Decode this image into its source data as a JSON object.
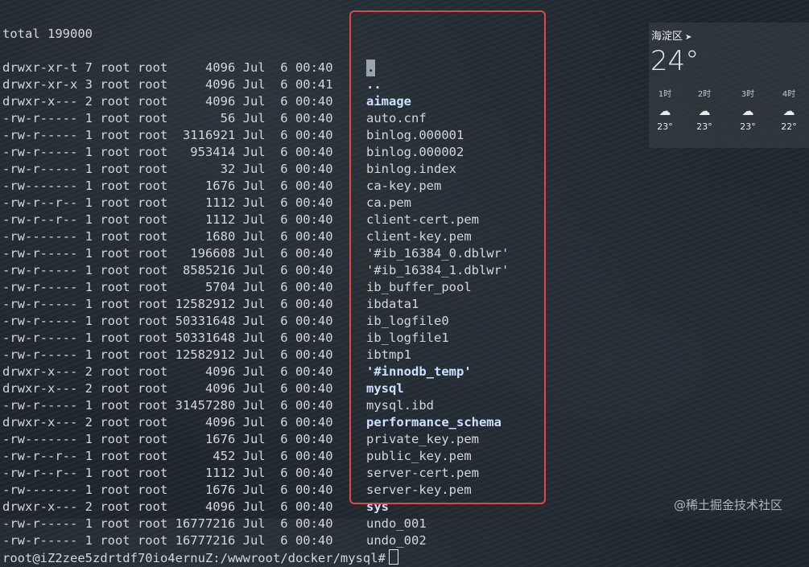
{
  "terminal": {
    "header": "total 199000",
    "rows": [
      {
        "meta": "drwxr-xr-t 7 root root     4096 Jul  6 00:40",
        "name": ".",
        "is_dir": true
      },
      {
        "meta": "drwxr-xr-x 3 root root     4096 Jul  6 00:41",
        "name": "..",
        "is_dir": true
      },
      {
        "meta": "drwxr-x--- 2 root root     4096 Jul  6 00:40",
        "name": "aimage",
        "is_dir": true
      },
      {
        "meta": "-rw-r----- 1 root root       56 Jul  6 00:40",
        "name": "auto.cnf",
        "is_dir": false
      },
      {
        "meta": "-rw-r----- 1 root root  3116921 Jul  6 00:40",
        "name": "binlog.000001",
        "is_dir": false
      },
      {
        "meta": "-rw-r----- 1 root root   953414 Jul  6 00:40",
        "name": "binlog.000002",
        "is_dir": false
      },
      {
        "meta": "-rw-r----- 1 root root       32 Jul  6 00:40",
        "name": "binlog.index",
        "is_dir": false
      },
      {
        "meta": "-rw------- 1 root root     1676 Jul  6 00:40",
        "name": "ca-key.pem",
        "is_dir": false
      },
      {
        "meta": "-rw-r--r-- 1 root root     1112 Jul  6 00:40",
        "name": "ca.pem",
        "is_dir": false
      },
      {
        "meta": "-rw-r--r-- 1 root root     1112 Jul  6 00:40",
        "name": "client-cert.pem",
        "is_dir": false
      },
      {
        "meta": "-rw------- 1 root root     1680 Jul  6 00:40",
        "name": "client-key.pem",
        "is_dir": false
      },
      {
        "meta": "-rw-r----- 1 root root   196608 Jul  6 00:40",
        "name": "'#ib_16384_0.dblwr'",
        "is_dir": false
      },
      {
        "meta": "-rw-r----- 1 root root  8585216 Jul  6 00:40",
        "name": "'#ib_16384_1.dblwr'",
        "is_dir": false
      },
      {
        "meta": "-rw-r----- 1 root root     5704 Jul  6 00:40",
        "name": "ib_buffer_pool",
        "is_dir": false
      },
      {
        "meta": "-rw-r----- 1 root root 12582912 Jul  6 00:40",
        "name": "ibdata1",
        "is_dir": false
      },
      {
        "meta": "-rw-r----- 1 root root 50331648 Jul  6 00:40",
        "name": "ib_logfile0",
        "is_dir": false
      },
      {
        "meta": "-rw-r----- 1 root root 50331648 Jul  6 00:40",
        "name": "ib_logfile1",
        "is_dir": false
      },
      {
        "meta": "-rw-r----- 1 root root 12582912 Jul  6 00:40",
        "name": "ibtmp1",
        "is_dir": false
      },
      {
        "meta": "drwxr-x--- 2 root root     4096 Jul  6 00:40",
        "name": "'#innodb_temp'",
        "is_dir": true
      },
      {
        "meta": "drwxr-x--- 2 root root     4096 Jul  6 00:40",
        "name": "mysql",
        "is_dir": true
      },
      {
        "meta": "-rw-r----- 1 root root 31457280 Jul  6 00:40",
        "name": "mysql.ibd",
        "is_dir": false
      },
      {
        "meta": "drwxr-x--- 2 root root     4096 Jul  6 00:40",
        "name": "performance_schema",
        "is_dir": true
      },
      {
        "meta": "-rw------- 1 root root     1676 Jul  6 00:40",
        "name": "private_key.pem",
        "is_dir": false
      },
      {
        "meta": "-rw-r--r-- 1 root root      452 Jul  6 00:40",
        "name": "public_key.pem",
        "is_dir": false
      },
      {
        "meta": "-rw-r--r-- 1 root root     1112 Jul  6 00:40",
        "name": "server-cert.pem",
        "is_dir": false
      },
      {
        "meta": "-rw------- 1 root root     1676 Jul  6 00:40",
        "name": "server-key.pem",
        "is_dir": false
      },
      {
        "meta": "drwxr-x--- 2 root root     4096 Jul  6 00:40",
        "name": "sys",
        "is_dir": true
      },
      {
        "meta": "-rw-r----- 1 root root 16777216 Jul  6 00:40",
        "name": "undo_001",
        "is_dir": false
      },
      {
        "meta": "-rw-r----- 1 root root 16777216 Jul  6 00:40",
        "name": "undo_002",
        "is_dir": false
      }
    ],
    "prompt": "root@iZ2zee5zdrtdf70io4ernuZ:/wwwroot/docker/mysql#"
  },
  "weather": {
    "location": "海淀区",
    "location_icon": "location-arrow-icon",
    "temperature": "24°",
    "hours": [
      {
        "label": "1时",
        "icon": "cloud-icon",
        "temp": "23°"
      },
      {
        "label": "2时",
        "icon": "cloud-icon",
        "temp": "23°"
      },
      {
        "label": "3时",
        "icon": "cloud-moon-icon",
        "temp": "23°"
      },
      {
        "label": "4时",
        "icon": "cloud-moon-icon",
        "temp": "22°"
      }
    ]
  },
  "watermark": "@稀土掘金技术社区",
  "colors": {
    "highlight_box": "#e0454a",
    "directory_text": "#cfe0ff",
    "terminal_text": "#d6d6d6"
  }
}
